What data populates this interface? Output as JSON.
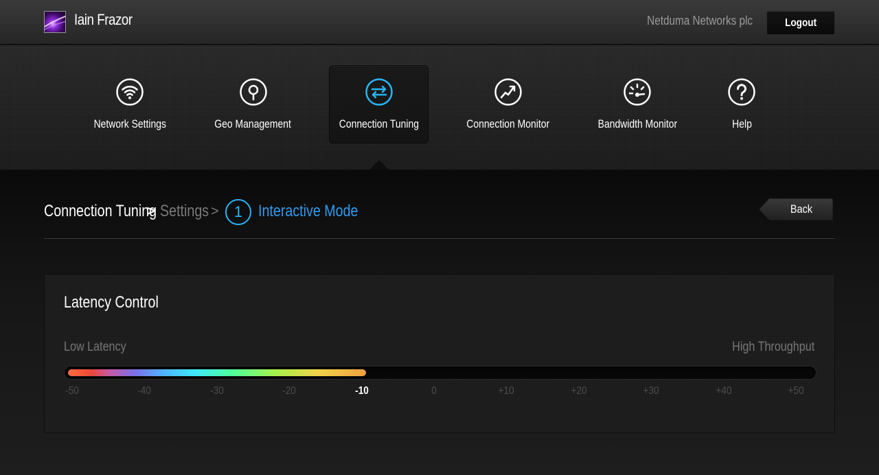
{
  "header": {
    "username": "Iain Frazor",
    "company": "Netduma Networks plc",
    "logout_label": "Logout"
  },
  "nav": {
    "items": [
      {
        "label": "Network Settings",
        "icon": "wifi-icon"
      },
      {
        "label": "Geo Management",
        "icon": "location-pin-icon"
      },
      {
        "label": "Connection Tuning",
        "icon": "transfer-arrows-icon",
        "active": true
      },
      {
        "label": "Connection Monitor",
        "icon": "trend-chart-icon"
      },
      {
        "label": "Bandwidth Monitor",
        "icon": "speedometer-icon"
      },
      {
        "label": "Help",
        "icon": "question-mark-icon"
      }
    ]
  },
  "breadcrumb": {
    "root": "Connection Tuning",
    "separator": ">",
    "middle": "Settings",
    "step_number": "1",
    "current": "Interactive Mode"
  },
  "back_label": "Back",
  "latency_control": {
    "title": "Latency Control",
    "low_label": "Low Latency",
    "high_label": "High Throughput",
    "value": -10,
    "min": -50,
    "max": 50,
    "ticks": [
      "-50",
      "-40",
      "-30",
      "-20",
      "-10",
      "0",
      "+10",
      "+20",
      "+30",
      "+40",
      "+50"
    ]
  },
  "colors": {
    "accent_blue": "#29b6f6",
    "breadcrumb_current": "#2e9bf0"
  }
}
